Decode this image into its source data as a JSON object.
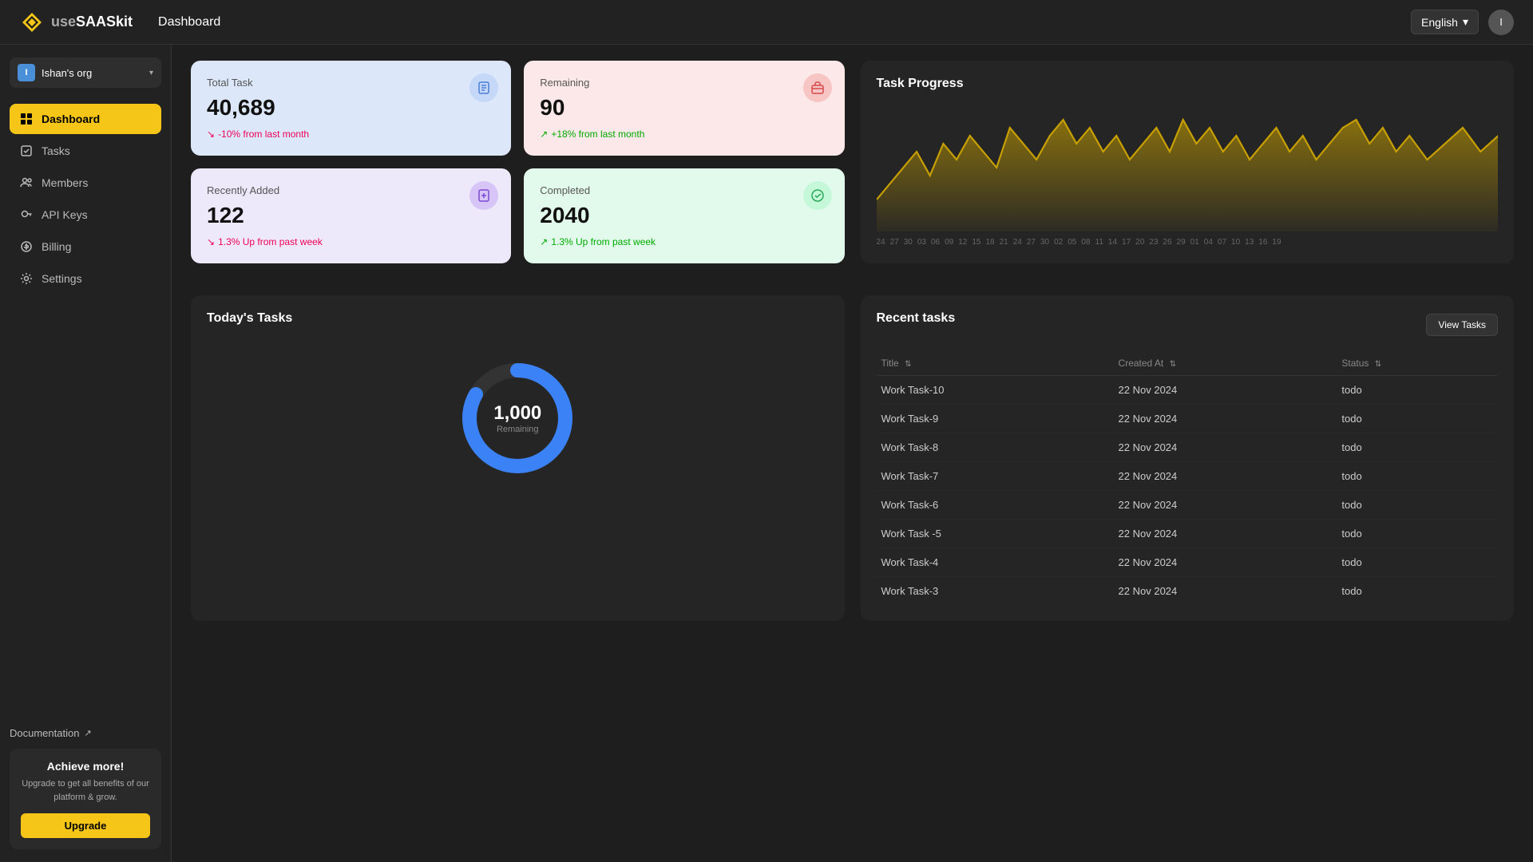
{
  "app": {
    "logo_use": "use",
    "logo_saas": "SAASkit",
    "page_title": "Dashboard",
    "language": "English",
    "user_initial": "I"
  },
  "sidebar": {
    "org": {
      "name": "Ishan's org",
      "initial": "I"
    },
    "nav_items": [
      {
        "id": "dashboard",
        "label": "Dashboard",
        "active": true,
        "icon": "grid"
      },
      {
        "id": "tasks",
        "label": "Tasks",
        "active": false,
        "icon": "check"
      },
      {
        "id": "members",
        "label": "Members",
        "active": false,
        "icon": "users"
      },
      {
        "id": "api-keys",
        "label": "API Keys",
        "active": false,
        "icon": "key"
      },
      {
        "id": "billing",
        "label": "Billing",
        "active": false,
        "icon": "dollar"
      },
      {
        "id": "settings",
        "label": "Settings",
        "active": false,
        "icon": "gear"
      }
    ],
    "docs_label": "Documentation",
    "upgrade_box": {
      "title": "Achieve more!",
      "description": "Upgrade to get all benefits of our platform & grow.",
      "button_label": "Upgrade"
    }
  },
  "stats": [
    {
      "id": "total-task",
      "label": "Total Task",
      "value": "40,689",
      "change": "-10% from last month",
      "change_dir": "down",
      "color": "blue"
    },
    {
      "id": "remaining",
      "label": "Remaining",
      "value": "90",
      "change": "+18% from last month",
      "change_dir": "up",
      "color": "pink"
    },
    {
      "id": "recently-added",
      "label": "Recently Added",
      "value": "122",
      "change": "1.3% Up from past week",
      "change_dir": "down",
      "color": "purple"
    },
    {
      "id": "completed",
      "label": "Completed",
      "value": "2040",
      "change": "1.3% Up from past week",
      "change_dir": "up",
      "color": "green"
    }
  ],
  "task_progress": {
    "title": "Task Progress",
    "x_labels": [
      "24",
      "27",
      "30",
      "03",
      "06",
      "09",
      "12",
      "15",
      "18",
      "21",
      "24",
      "27",
      "30",
      "02",
      "05",
      "08",
      "11",
      "14",
      "17",
      "20",
      "23",
      "26",
      "29",
      "01",
      "04",
      "07",
      "10",
      "13",
      "16",
      "19"
    ]
  },
  "todays_tasks": {
    "title": "Today's Tasks",
    "donut_value": "1,000",
    "donut_sub": "Remaining",
    "total": 1200,
    "remaining": 1000
  },
  "recent_tasks": {
    "title": "Recent tasks",
    "view_button": "View Tasks",
    "columns": [
      {
        "label": "Title",
        "id": "title"
      },
      {
        "label": "Created At",
        "id": "created_at"
      },
      {
        "label": "Status",
        "id": "status"
      }
    ],
    "rows": [
      {
        "title": "Work Task-10",
        "created_at": "22 Nov 2024",
        "status": "todo"
      },
      {
        "title": "Work Task-9",
        "created_at": "22 Nov 2024",
        "status": "todo"
      },
      {
        "title": "Work Task-8",
        "created_at": "22 Nov 2024",
        "status": "todo"
      },
      {
        "title": "Work Task-7",
        "created_at": "22 Nov 2024",
        "status": "todo"
      },
      {
        "title": "Work Task-6",
        "created_at": "22 Nov 2024",
        "status": "todo"
      },
      {
        "title": "Work Task -5",
        "created_at": "22 Nov 2024",
        "status": "todo"
      },
      {
        "title": "Work Task-4",
        "created_at": "22 Nov 2024",
        "status": "todo"
      },
      {
        "title": "Work Task-3",
        "created_at": "22 Nov 2024",
        "status": "todo"
      }
    ]
  }
}
